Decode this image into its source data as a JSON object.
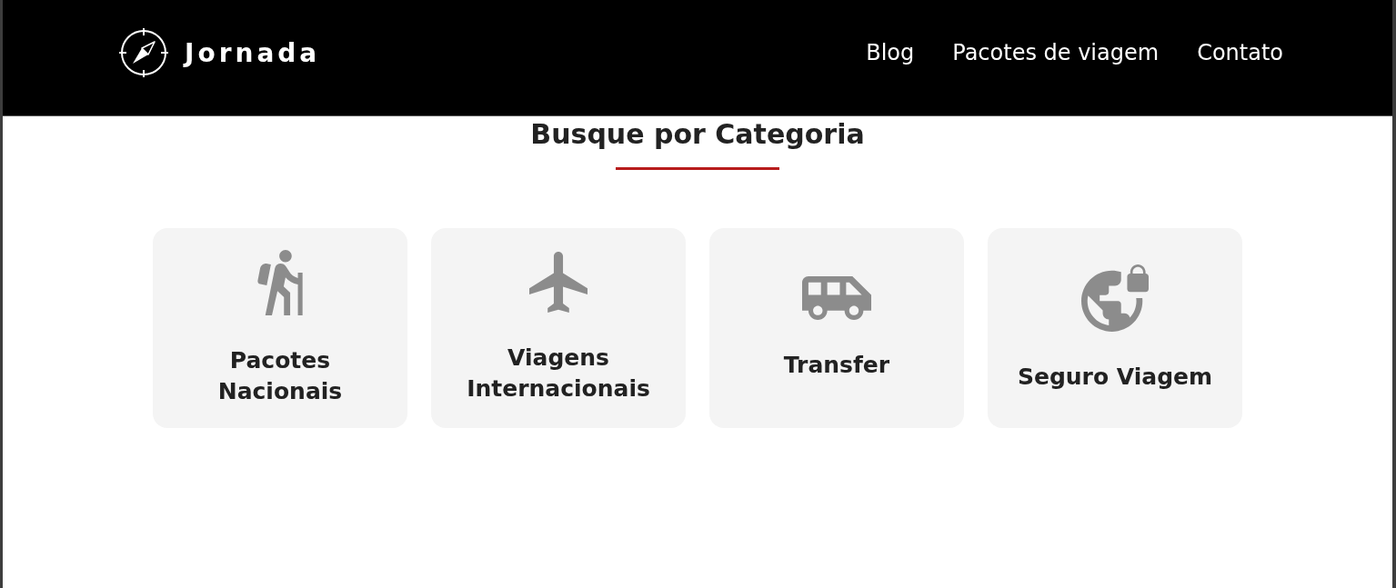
{
  "header": {
    "logo": {
      "text": "Jornada"
    },
    "nav": [
      {
        "label": "Blog"
      },
      {
        "label": "Pacotes de viagem"
      },
      {
        "label": "Contato"
      }
    ]
  },
  "section": {
    "title": "Busque por Categoria"
  },
  "categories": [
    {
      "kind": "national",
      "label": "Pacotes Nacionais"
    },
    {
      "kind": "international",
      "label": "Viagens Internacionais"
    },
    {
      "kind": "transfer",
      "label": "Transfer"
    },
    {
      "kind": "insurance",
      "label": "Seguro Viagem"
    }
  ]
}
